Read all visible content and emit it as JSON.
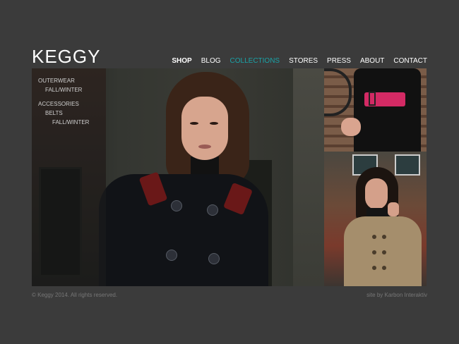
{
  "header": {
    "logo": "KEGGY",
    "nav": [
      {
        "label": "SHOP"
      },
      {
        "label": "BLOG"
      },
      {
        "label": "COLLECTIONS"
      },
      {
        "label": "STORES"
      },
      {
        "label": "PRESS"
      },
      {
        "label": "ABOUT"
      },
      {
        "label": "CONTACT"
      }
    ]
  },
  "sidebar": {
    "items": [
      {
        "label": "OUTERWEAR"
      },
      {
        "label": "FALL/WINTER"
      },
      {
        "label": "ACCESSORIES"
      },
      {
        "label": "BELTS"
      },
      {
        "label": "FALL/WINTER"
      }
    ]
  },
  "footer": {
    "copyright": "© Keggy 2014. All rights reserved.",
    "credit": "site by Karbon Interaktiv"
  },
  "colors": {
    "background": "#3b3b3b",
    "nav_active": "#1aa3a7",
    "belt_accent": "#d32a64"
  }
}
